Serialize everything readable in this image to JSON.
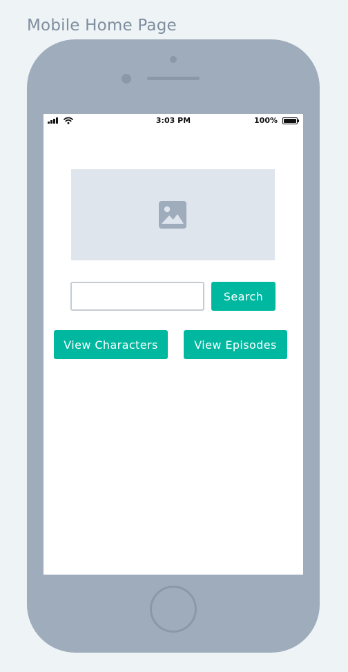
{
  "page_label": "Mobile Home Page",
  "status_bar": {
    "time": "3:03 PM",
    "battery_percent": "100%",
    "battery_level": 1.0,
    "signal_bars": 4,
    "icons": [
      "signal-icon",
      "wifi-icon",
      "battery-icon"
    ]
  },
  "hero": {
    "icon": "image-icon"
  },
  "search": {
    "value": "",
    "placeholder": "",
    "button_label": "Search"
  },
  "actions": {
    "view_characters_label": "View Characters",
    "view_episodes_label": "View Episodes"
  },
  "colors": {
    "accent": "#00b8a0",
    "phone_body": "#9eacbb",
    "placeholder_bg": "#dfe5ed",
    "placeholder_icon": "#9eacbb",
    "page_bg": "#eef3f6"
  }
}
